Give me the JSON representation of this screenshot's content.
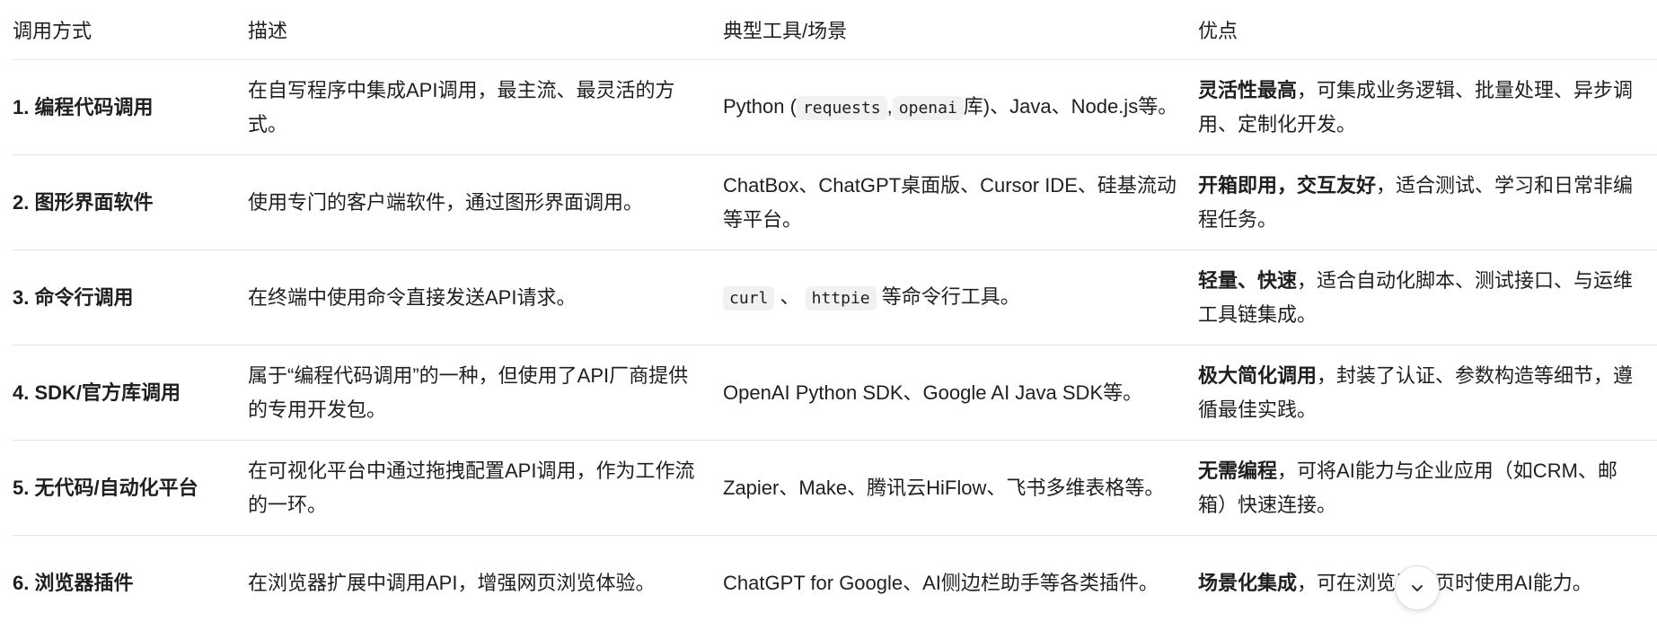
{
  "table": {
    "headers": [
      "调用方式",
      "描述",
      "典型工具/场景",
      "优点"
    ],
    "rows": [
      {
        "method": "1. 编程代码调用",
        "desc": "在自写程序中集成API调用，最主流、最灵活的方式。",
        "tools_pre": "Python (",
        "code1": "requests",
        "tools_sep": ",",
        "code2": "openai",
        "tools_post": "库)、Java、Node.js等。",
        "pro_bold": "灵活性最高",
        "pro_rest": "，可集成业务逻辑、批量处理、异步调用、定制化开发。"
      },
      {
        "method": "2. 图形界面软件",
        "desc": "使用专门的客户端软件，通过图形界面调用。",
        "tools": "ChatBox、ChatGPT桌面版、Cursor IDE、硅基流动等平台。",
        "pro_bold": "开箱即用，交互友好",
        "pro_rest": "，适合测试、学习和日常非编程任务。"
      },
      {
        "method": "3. 命令行调用",
        "desc": "在终端中使用命令直接发送API请求。",
        "code1": "curl",
        "tools_sep": "、",
        "code2": "httpie",
        "tools_post": "等命令行工具。",
        "pro_bold": "轻量、快速",
        "pro_rest": "，适合自动化脚本、测试接口、与运维工具链集成。"
      },
      {
        "method": "4. SDK/官方库调用",
        "desc": "属于“编程代码调用”的一种，但使用了API厂商提供的专用开发包。",
        "tools": "OpenAI Python SDK、Google AI Java SDK等。",
        "pro_bold": "极大简化调用",
        "pro_rest": "，封装了认证、参数构造等细节，遵循最佳实践。"
      },
      {
        "method": "5. 无代码/自动化平台",
        "desc": "在可视化平台中通过拖拽配置API调用，作为工作流的一环。",
        "tools": "Zapier、Make、腾讯云HiFlow、飞书多维表格等。",
        "pro_bold": "无需编程",
        "pro_rest": "，可将AI能力与企业应用（如CRM、邮箱）快速连接。"
      },
      {
        "method": "6. 浏览器插件",
        "desc": "在浏览器扩展中调用API，增强网页浏览体验。",
        "tools": "ChatGPT for Google、AI侧边栏助手等各类插件。",
        "pro_bold": "场景化集成",
        "pro_rest": "，可在浏览器网页时使用AI能力。"
      }
    ]
  },
  "scroll_button": {
    "icon": "chevron-down-icon"
  }
}
